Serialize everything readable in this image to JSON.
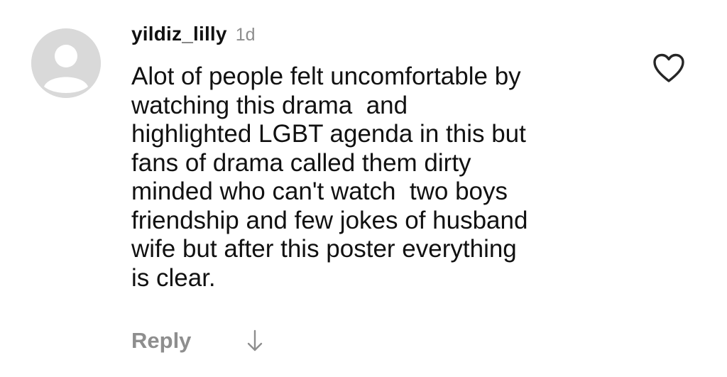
{
  "comment": {
    "username": "yildiz_lilly",
    "timestamp": "1d",
    "avatar_icon": "default-avatar-icon",
    "text_lines": [
      "Alot of people felt uncomfortable by",
      "watching this drama  and",
      "highlighted LGBT agenda in this but",
      "fans of drama called them dirty",
      "minded who can't watch  two boys",
      "friendship and few jokes of husband",
      "wife but after this poster everything",
      "is clear."
    ],
    "like_icon": "heart-outline-icon",
    "reply_label": "Reply",
    "expand_icon": "arrow-down-icon"
  },
  "colors": {
    "text": "#111111",
    "muted": "#8e8e8e",
    "avatar_bg": "#d9d9d9",
    "avatar_fg": "#ffffff"
  }
}
